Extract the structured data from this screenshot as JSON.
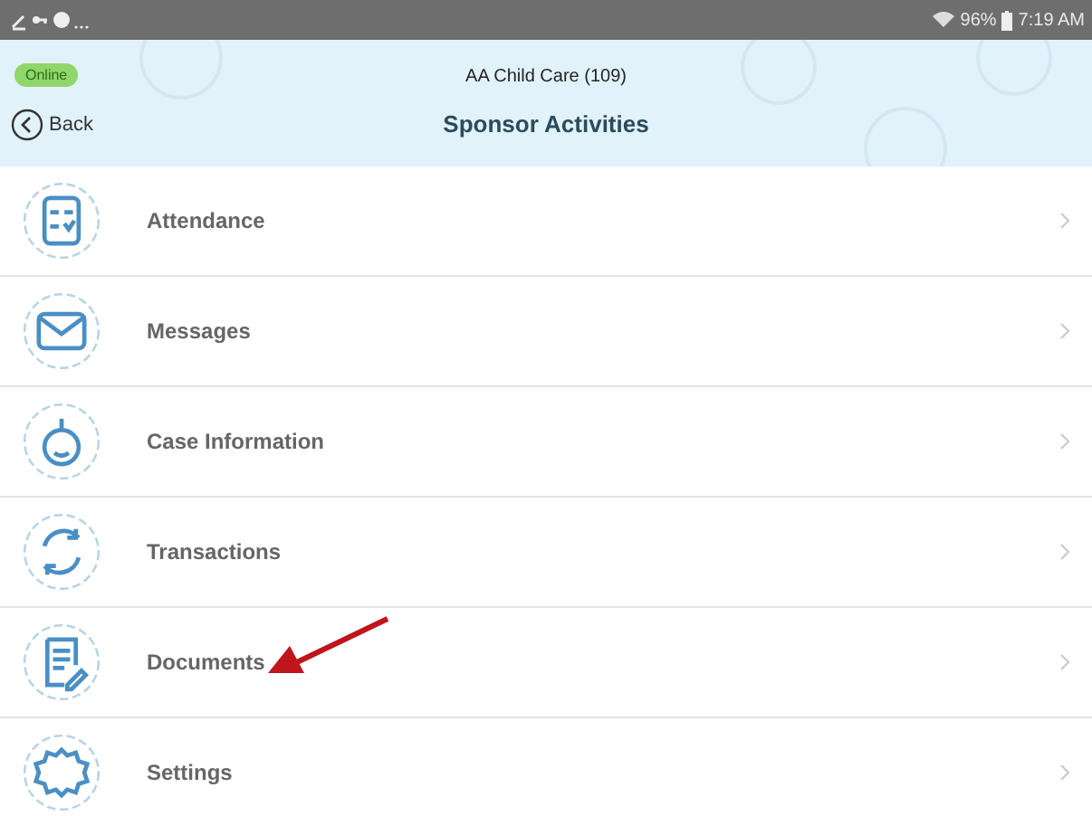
{
  "status_bar": {
    "battery": "96%",
    "time": "7:19 AM"
  },
  "header": {
    "badge": "Online",
    "subtitle": "AA Child Care (109)",
    "back": "Back",
    "title": "Sponsor Activities"
  },
  "items": [
    {
      "label": "Attendance",
      "kind": "attendance",
      "pointed": false
    },
    {
      "label": "Messages",
      "kind": "messages",
      "pointed": false
    },
    {
      "label": "Case Information",
      "kind": "case",
      "pointed": false
    },
    {
      "label": "Transactions",
      "kind": "transactions",
      "pointed": false
    },
    {
      "label": "Documents",
      "kind": "documents",
      "pointed": true
    },
    {
      "label": "Settings",
      "kind": "settings",
      "pointed": false
    }
  ]
}
